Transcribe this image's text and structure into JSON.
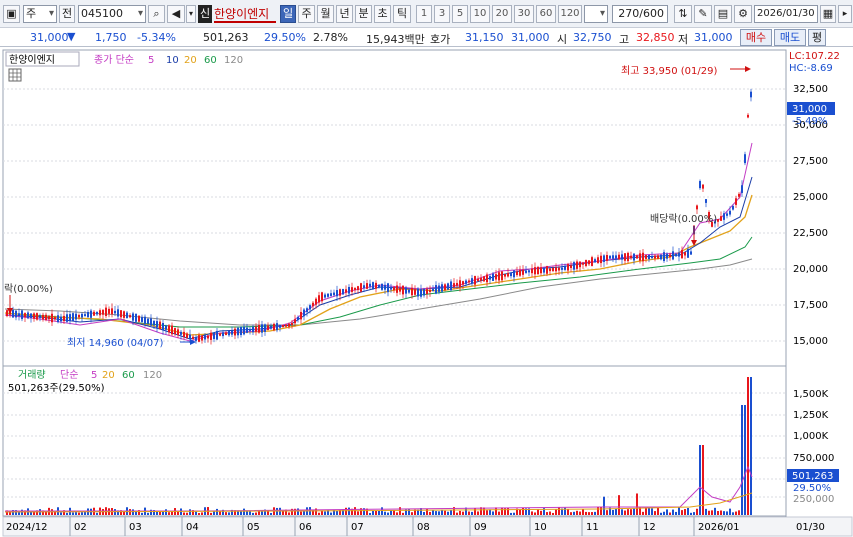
{
  "toolbar": {
    "type_select": "주",
    "market_label": "전",
    "code_value": "045100",
    "credit_badge": "신",
    "stock_name": "한양이엔지",
    "period_tabs": [
      "일",
      "주",
      "월",
      "년",
      "분",
      "초",
      "틱"
    ],
    "interval_tabs": [
      "1",
      "3",
      "5",
      "10",
      "20",
      "30",
      "60",
      "120"
    ],
    "count_value": "270",
    "count_max": "/600",
    "date_value": "2026/01/30"
  },
  "quote": {
    "price": "31,000",
    "change_icon": "down-triangle",
    "change": "1,750",
    "change_pct": "-5.34%",
    "volume": "501,263",
    "volume_ratio": "29.50%",
    "turnover_pct": "2.78%",
    "trade_value": "15,943백만",
    "ask_label": "호가",
    "ask1": "31,150",
    "ask2": "31,000",
    "open_label": "시",
    "open": "32,750",
    "high_label": "고",
    "high": "32,850",
    "low_label": "저",
    "low": "31,000",
    "buy_btn": "매수",
    "sell_btn": "매도",
    "eval_btn": "평"
  },
  "price_panel": {
    "legend_name": "한양이엔지",
    "legend_ma": "종가 단순",
    "ma_periods": [
      "5",
      "10",
      "20",
      "60",
      "120"
    ],
    "lc_label": "LC:107.22",
    "hc_label": "HC:-8.69",
    "current_price_tag": "31,000",
    "current_pct_tag": "-5.49%",
    "high_annotation": "최고 33,950 (01/29)",
    "low_annotation": "최저 14,960 (04/07)",
    "dividend_annotation": "배당락(0.00%)",
    "left_annotation": "락(0.00%)",
    "y_ticks": [
      "32,500",
      "30,000",
      "27,500",
      "25,000",
      "22,500",
      "20,000",
      "17,500",
      "15,000"
    ]
  },
  "volume_panel": {
    "legend_name": "거래량",
    "legend_ma": "단순",
    "ma_periods": [
      "5",
      "20",
      "60",
      "120"
    ],
    "current_volume": "501,263주(29.50%)",
    "volume_tag": "501,263",
    "pct_tag": "29.50%",
    "y_ticks": [
      "1,500K",
      "1,250K",
      "1,000K",
      "750,000",
      "500,000",
      "250,000"
    ]
  },
  "x_axis": [
    "2024/12",
    "02",
    "03",
    "04",
    "05",
    "06",
    "07",
    "08",
    "09",
    "10",
    "11",
    "12",
    "2026/01"
  ],
  "x_axis_right": "01/30",
  "colors": {
    "up": "#e8171c",
    "down": "#1a4fd0",
    "ma5": "#c43cc4",
    "ma10": "#1b3da8",
    "ma20": "#e2a21a",
    "ma60": "#1a9a4a",
    "ma120": "#8a8a8a"
  }
}
